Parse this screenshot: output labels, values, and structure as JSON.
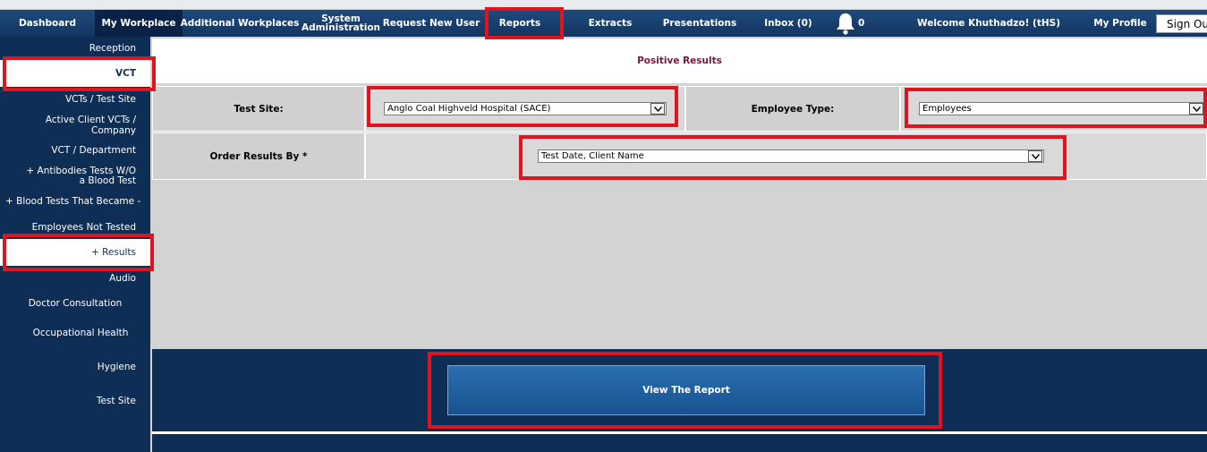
{
  "nav": {
    "items": [
      {
        "label": "Dashboard"
      },
      {
        "label": "My Workplace"
      },
      {
        "label": "Additional Workplaces"
      },
      {
        "label": "System Administration"
      },
      {
        "label": "Request New User"
      },
      {
        "label": "Reports"
      },
      {
        "label": "Extracts"
      },
      {
        "label": "Presentations"
      },
      {
        "label": "Inbox (0)"
      }
    ],
    "notification_count": "0",
    "welcome": "Welcome Khuthadzo! (tHS)",
    "my_profile": "My Profile",
    "sign_out": "Sign Out"
  },
  "sidebar": {
    "items": [
      {
        "label": "Reception"
      },
      {
        "label": "VCT"
      },
      {
        "label": "VCTs / Test Site"
      },
      {
        "label": "Active Client VCTs / Company"
      },
      {
        "label": "VCT / Department"
      },
      {
        "label": "+ Antibodies Tests W/O a Blood Test"
      },
      {
        "label": "+ Blood Tests That Became -"
      },
      {
        "label": "Employees Not Tested"
      },
      {
        "label": "+ Results"
      },
      {
        "label": "Audio"
      },
      {
        "label": "Doctor Consultation"
      },
      {
        "label": "Occupational Health"
      },
      {
        "label": "Hygiene"
      },
      {
        "label": "Test Site"
      }
    ]
  },
  "main": {
    "title": "Positive Results",
    "test_site_label": "Test Site:",
    "test_site_value": "Anglo Coal Highveld Hospital (SACE)",
    "employee_type_label": "Employee Type:",
    "employee_type_value": "Employees",
    "order_by_label": "Order Results By *",
    "order_by_value": "Test Date, Client Name",
    "view_button": "View The Report"
  },
  "colors": {
    "navy": "#0f2e55",
    "title_maroon": "#7a1546",
    "highlight_red": "#e0141e",
    "button_blue": "#2b6fb0"
  }
}
